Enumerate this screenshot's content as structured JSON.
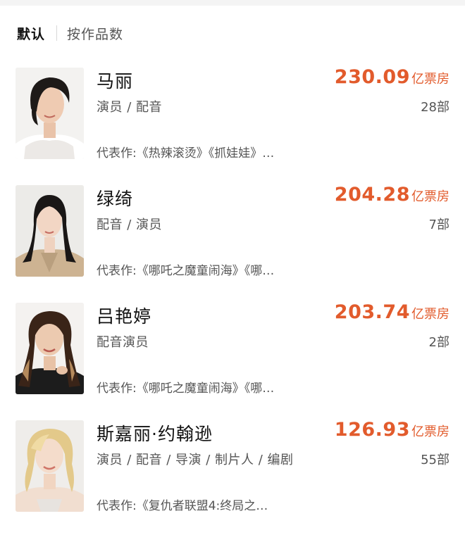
{
  "sort": {
    "default_label": "默认",
    "by_works_label": "按作品数"
  },
  "people": [
    {
      "name": "马丽",
      "roles": "演员 / 配音",
      "box_office_value": "230.09",
      "box_office_unit": "亿票房",
      "works_count": "28部",
      "representative_works": "代表作:《热辣滚烫》《抓娃娃》…"
    },
    {
      "name": "绿绮",
      "roles": "配音 / 演员",
      "box_office_value": "204.28",
      "box_office_unit": "亿票房",
      "works_count": "7部",
      "representative_works": "代表作:《哪吒之魔童闹海》《哪…"
    },
    {
      "name": "吕艳婷",
      "roles": "配音演员",
      "box_office_value": "203.74",
      "box_office_unit": "亿票房",
      "works_count": "2部",
      "representative_works": "代表作:《哪吒之魔童闹海》《哪…"
    },
    {
      "name": "斯嘉丽·约翰逊",
      "roles": "演员 / 配音 / 导演 / 制片人 / 编剧",
      "box_office_value": "126.93",
      "box_office_unit": "亿票房",
      "works_count": "55部",
      "representative_works": "代表作:《复仇者联盟4:终局之…"
    }
  ],
  "colors": {
    "box_office": "#e25b2c",
    "name": "#111111",
    "secondary_text": "#555555",
    "divider": "#d8d8d8"
  }
}
